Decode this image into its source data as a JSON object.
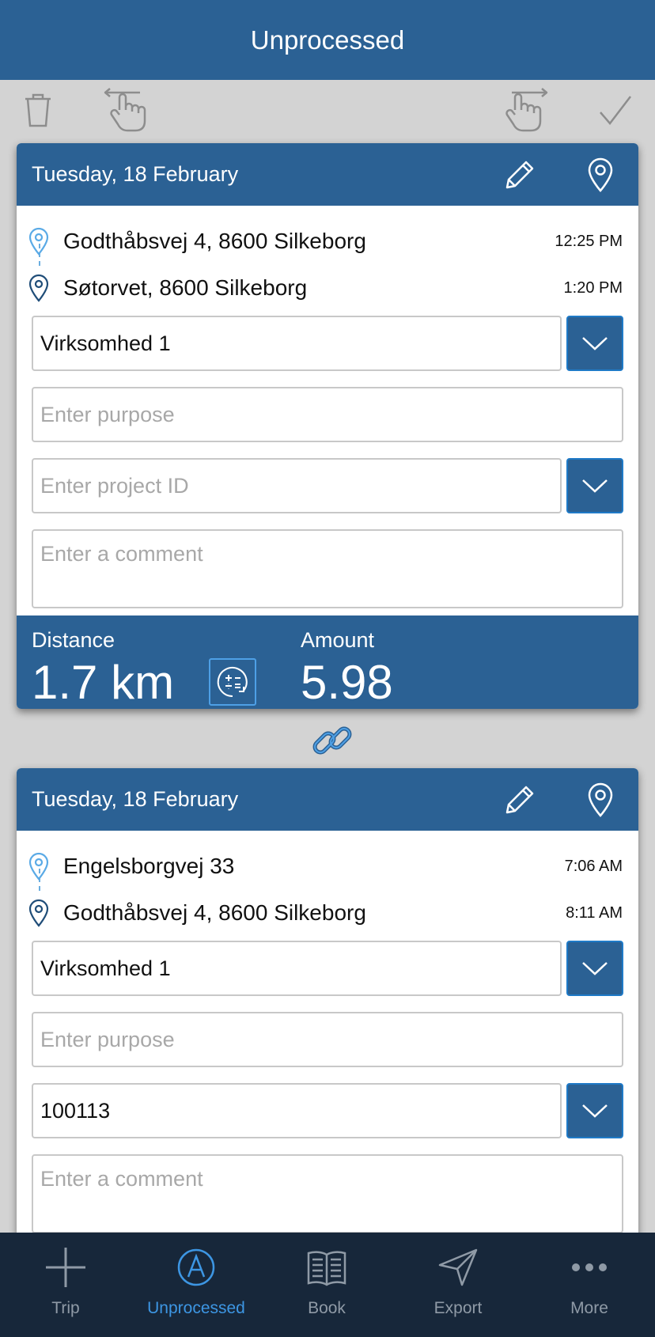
{
  "header": {
    "title": "Unprocessed"
  },
  "toolbar": {
    "icons": [
      "trash-icon",
      "swipe-left-hand-icon",
      "swipe-right-hand-icon",
      "checkmark-icon"
    ]
  },
  "colors": {
    "brand": "#2b6194",
    "accent": "#3d96e3",
    "tabbar": "#17273a",
    "background": "#d3d3d3"
  },
  "trips": [
    {
      "date": "Tuesday, 18 February",
      "start_address": "Godthåbsvej 4, 8600 Silkeborg",
      "start_time": "12:25 PM",
      "end_address": "Søtorvet, 8600 Silkeborg",
      "end_time": "1:20 PM",
      "company": "Virksomhed 1",
      "purpose_placeholder": "Enter purpose",
      "project_placeholder": "Enter project ID",
      "project_value": "",
      "comment_placeholder": "Enter a comment",
      "distance_label": "Distance",
      "distance_value": "1.7 km",
      "amount_label": "Amount",
      "amount_value": "5.98"
    },
    {
      "date": "Tuesday, 18 February",
      "start_address": "Engelsborgvej 33",
      "start_time": "7:06 AM",
      "end_address": "Godthåbsvej 4, 8600 Silkeborg",
      "end_time": "8:11 AM",
      "company": "Virksomhed 1",
      "purpose_placeholder": "Enter purpose",
      "project_value": "100113",
      "comment_placeholder": "Enter a comment"
    }
  ],
  "tabs": [
    {
      "label": "Trip",
      "icon": "plus-icon",
      "active": false
    },
    {
      "label": "Unprocessed",
      "icon": "circle-a-icon",
      "active": true
    },
    {
      "label": "Book",
      "icon": "book-icon",
      "active": false
    },
    {
      "label": "Export",
      "icon": "paper-plane-icon",
      "active": false
    },
    {
      "label": "More",
      "icon": "more-dots-icon",
      "active": false
    }
  ]
}
